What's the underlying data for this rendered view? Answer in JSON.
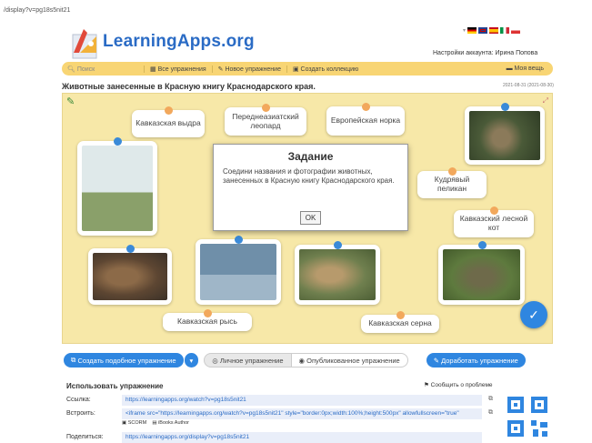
{
  "browser": {
    "url": "/display?v=pg18s5nit21"
  },
  "header": {
    "logo_text": "LearningApps.org",
    "account": "Настройки аккаунта: Ирина Попова"
  },
  "nav": {
    "search_placeholder": "Поиск",
    "items": [
      "Все упражнения",
      "Новое упражнение",
      "Создать коллекцию"
    ],
    "my_stuff": "Моя вещь"
  },
  "page": {
    "title": "Животные занесенные в Красную книгу Краснодарского края.",
    "date": "2021-08-31 (2021-08-30)"
  },
  "board": {
    "labels": [
      "Кавказская выдра",
      "Переднеазиатский леопард",
      "Европейская норка",
      "Кудрявый пеликан",
      "Кавказский лесной кот",
      "Кавказская рысь",
      "Кавказская серна"
    ],
    "dialog": {
      "title": "Задание",
      "text": "Соедини названия и фотографии животных, занесенных в Красную книгу Краснодарского края.",
      "ok": "OK"
    }
  },
  "toolbar": {
    "create_similar": "Создать подобное упражнение",
    "personal": "Личное упражнение",
    "published": "Опубликованное упражнение",
    "improve": "Доработать упражнение"
  },
  "usage": {
    "title": "Использовать упражнение",
    "report": "Сообщить о проблеме",
    "link_label": "Ссылка:",
    "link_value": "https://learningapps.org/watch?v=pg18s5nit21",
    "embed_label": "Встроить:",
    "embed_value": "<iframe src=\"https://learningapps.org/watch?v=pg18s5nit21\" style=\"border:0px;width:100%;height:500px\" allowfullscreen=\"true\"",
    "scorm": "SCORM",
    "ibooks": "iBooks Author",
    "share_label": "Поделиться:",
    "share_value": "https://learningapps.org/display?v=pg18s5nit21"
  },
  "colors": {
    "accent": "#2f86e0",
    "nav_bg": "#f8d574",
    "board_bg": "#f7e8a8"
  }
}
